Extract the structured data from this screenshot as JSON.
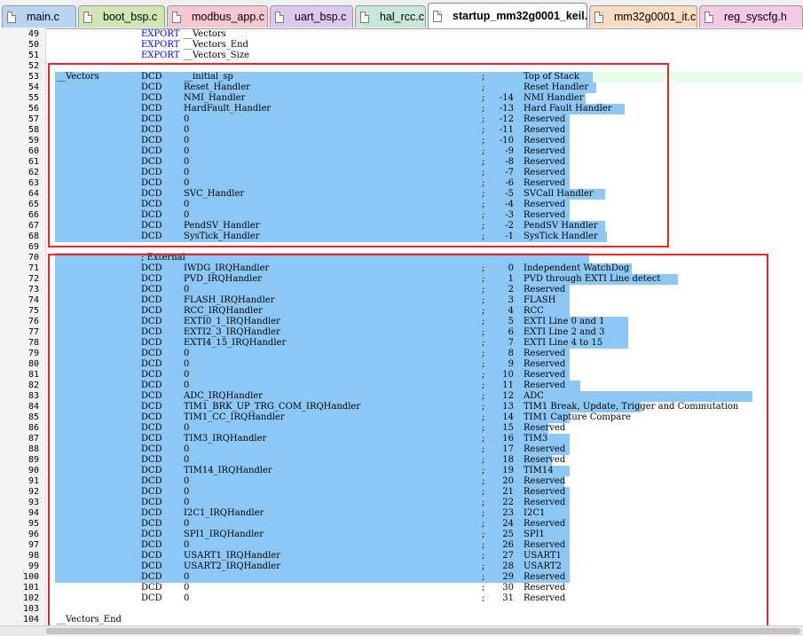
{
  "tabs": [
    {
      "label": "main.c",
      "color": "#b9d4f1",
      "active": false
    },
    {
      "label": "boot_bsp.c",
      "color": "#cfe6b3",
      "active": false
    },
    {
      "label": "modbus_app.c",
      "color": "#f6c7d3",
      "active": false
    },
    {
      "label": "uart_bsp.c",
      "color": "#dcc8ef",
      "active": false
    },
    {
      "label": "hal_rcc.c",
      "color": "#c7e8d9",
      "active": false
    },
    {
      "label": "startup_mm32g0001_keil.s",
      "color": "#ffffff",
      "active": true
    },
    {
      "label": "mm32g0001_it.c",
      "color": "#f9dcc0",
      "active": false
    },
    {
      "label": "reg_syscfg.h",
      "color": "#f3c9e6",
      "active": false
    }
  ],
  "colors": {
    "selection": "#8cc7f5",
    "keyword": "#0000ff",
    "highlight_box": "#e8262a",
    "current_line": "#e8ffe8"
  },
  "lines": [
    {
      "n": "49",
      "c1": "",
      "c2": "EXPORT",
      "c3": "__Vectors",
      "semi": "",
      "num": "",
      "cmt": "",
      "kw": true
    },
    {
      "n": "50",
      "c1": "",
      "c2": "EXPORT",
      "c3": "__Vectors_End",
      "semi": "",
      "num": "",
      "cmt": "",
      "kw": true
    },
    {
      "n": "51",
      "c1": "",
      "c2": "EXPORT",
      "c3": "__Vectors_Size",
      "semi": "",
      "num": "",
      "cmt": "",
      "kw": true
    },
    {
      "n": "52",
      "c1": "",
      "c2": "",
      "c3": "",
      "semi": "",
      "num": "",
      "cmt": ""
    },
    {
      "n": "53",
      "c1": "__Vectors",
      "c2": "DCD",
      "c3": "__initial_sp",
      "semi": ";",
      "num": "",
      "cmt": "Top of Stack"
    },
    {
      "n": "54",
      "c1": "",
      "c2": "DCD",
      "c3": "Reset_Handler",
      "semi": ";",
      "num": "",
      "cmt": "Reset Handler"
    },
    {
      "n": "55",
      "c1": "",
      "c2": "DCD",
      "c3": "NMI_Handler",
      "semi": ";",
      "num": "-14",
      "cmt": "NMI Handler"
    },
    {
      "n": "56",
      "c1": "",
      "c2": "DCD",
      "c3": "HardFault_Handler",
      "semi": ";",
      "num": "-13",
      "cmt": "Hard Fault Handler"
    },
    {
      "n": "57",
      "c1": "",
      "c2": "DCD",
      "c3": "0",
      "semi": ";",
      "num": "-12",
      "cmt": "Reserved"
    },
    {
      "n": "58",
      "c1": "",
      "c2": "DCD",
      "c3": "0",
      "semi": ";",
      "num": "-11",
      "cmt": "Reserved"
    },
    {
      "n": "59",
      "c1": "",
      "c2": "DCD",
      "c3": "0",
      "semi": ";",
      "num": "-10",
      "cmt": "Reserved"
    },
    {
      "n": "60",
      "c1": "",
      "c2": "DCD",
      "c3": "0",
      "semi": ";",
      "num": "-9",
      "cmt": "Reserved"
    },
    {
      "n": "61",
      "c1": "",
      "c2": "DCD",
      "c3": "0",
      "semi": ";",
      "num": "-8",
      "cmt": "Reserved"
    },
    {
      "n": "62",
      "c1": "",
      "c2": "DCD",
      "c3": "0",
      "semi": ";",
      "num": "-7",
      "cmt": "Reserved"
    },
    {
      "n": "63",
      "c1": "",
      "c2": "DCD",
      "c3": "0",
      "semi": ";",
      "num": "-6",
      "cmt": "Reserved"
    },
    {
      "n": "64",
      "c1": "",
      "c2": "DCD",
      "c3": "SVC_Handler",
      "semi": ";",
      "num": "-5",
      "cmt": "SVCall Handler"
    },
    {
      "n": "65",
      "c1": "",
      "c2": "DCD",
      "c3": "0",
      "semi": ";",
      "num": "-4",
      "cmt": "Reserved"
    },
    {
      "n": "66",
      "c1": "",
      "c2": "DCD",
      "c3": "0",
      "semi": ";",
      "num": "-3",
      "cmt": "Reserved"
    },
    {
      "n": "67",
      "c1": "",
      "c2": "DCD",
      "c3": "PendSV_Handler",
      "semi": ";",
      "num": "-2",
      "cmt": "PendSV Handler"
    },
    {
      "n": "68",
      "c1": "",
      "c2": "DCD",
      "c3": "SysTick_Handler",
      "semi": ";",
      "num": "-1",
      "cmt": "SysTick Handler"
    },
    {
      "n": "69",
      "c1": "",
      "c2": "",
      "c3": "",
      "semi": "",
      "num": "",
      "cmt": ""
    },
    {
      "n": "70",
      "c1": "",
      "c2": "; External",
      "c3": "",
      "semi": "",
      "num": "",
      "cmt": ""
    },
    {
      "n": "71",
      "c1": "",
      "c2": "DCD",
      "c3": "IWDG_IRQHandler",
      "semi": ";",
      "num": "0",
      "cmt": "Independent WatchDog"
    },
    {
      "n": "72",
      "c1": "",
      "c2": "DCD",
      "c3": "PVD_IRQHandler",
      "semi": ";",
      "num": "1",
      "cmt": "PVD through EXTI Line detect"
    },
    {
      "n": "73",
      "c1": "",
      "c2": "DCD",
      "c3": "0",
      "semi": ";",
      "num": "2",
      "cmt": "Reserved"
    },
    {
      "n": "74",
      "c1": "",
      "c2": "DCD",
      "c3": "FLASH_IRQHandler",
      "semi": ";",
      "num": "3",
      "cmt": "FLASH"
    },
    {
      "n": "75",
      "c1": "",
      "c2": "DCD",
      "c3": "RCC_IRQHandler",
      "semi": ";",
      "num": "4",
      "cmt": "RCC"
    },
    {
      "n": "76",
      "c1": "",
      "c2": "DCD",
      "c3": "EXTI0_1_IRQHandler",
      "semi": ";",
      "num": "5",
      "cmt": "EXTI Line 0 and 1"
    },
    {
      "n": "77",
      "c1": "",
      "c2": "DCD",
      "c3": "EXTI2_3_IRQHandler",
      "semi": ";",
      "num": "6",
      "cmt": "EXTI Line 2 and 3"
    },
    {
      "n": "78",
      "c1": "",
      "c2": "DCD",
      "c3": "EXTI4_15_IRQHandler",
      "semi": ";",
      "num": "7",
      "cmt": "EXTI Line 4 to 15"
    },
    {
      "n": "79",
      "c1": "",
      "c2": "DCD",
      "c3": "0",
      "semi": ";",
      "num": "8",
      "cmt": "Reserved"
    },
    {
      "n": "80",
      "c1": "",
      "c2": "DCD",
      "c3": "0",
      "semi": ";",
      "num": "9",
      "cmt": "Reserved"
    },
    {
      "n": "81",
      "c1": "",
      "c2": "DCD",
      "c3": "0",
      "semi": ";",
      "num": "10",
      "cmt": "Reserved"
    },
    {
      "n": "82",
      "c1": "",
      "c2": "DCD",
      "c3": "0",
      "semi": ";",
      "num": "11",
      "cmt": "Reserved"
    },
    {
      "n": "83",
      "c1": "",
      "c2": "DCD",
      "c3": "ADC_IRQHandler",
      "semi": ";",
      "num": "12",
      "cmt": "ADC"
    },
    {
      "n": "84",
      "c1": "",
      "c2": "DCD",
      "c3": "TIM1_BRK_UP_TRG_COM_IRQHandler",
      "semi": ";",
      "num": "13",
      "cmt": "TIM1 Break, Update, Trigger and Commutation"
    },
    {
      "n": "85",
      "c1": "",
      "c2": "DCD",
      "c3": "TIM1_CC_IRQHandler",
      "semi": ";",
      "num": "14",
      "cmt": "TIM1 Capture Compare"
    },
    {
      "n": "86",
      "c1": "",
      "c2": "DCD",
      "c3": "0",
      "semi": ";",
      "num": "15",
      "cmt": "Reserved"
    },
    {
      "n": "87",
      "c1": "",
      "c2": "DCD",
      "c3": "TIM3_IRQHandler",
      "semi": ";",
      "num": "16",
      "cmt": "TIM3"
    },
    {
      "n": "88",
      "c1": "",
      "c2": "DCD",
      "c3": "0",
      "semi": ";",
      "num": "17",
      "cmt": "Reserved"
    },
    {
      "n": "89",
      "c1": "",
      "c2": "DCD",
      "c3": "0",
      "semi": ";",
      "num": "18",
      "cmt": "Reserved"
    },
    {
      "n": "90",
      "c1": "",
      "c2": "DCD",
      "c3": "TIM14_IRQHandler",
      "semi": ";",
      "num": "19",
      "cmt": "TIM14"
    },
    {
      "n": "91",
      "c1": "",
      "c2": "DCD",
      "c3": "0",
      "semi": ";",
      "num": "20",
      "cmt": "Reserved"
    },
    {
      "n": "92",
      "c1": "",
      "c2": "DCD",
      "c3": "0",
      "semi": ";",
      "num": "21",
      "cmt": "Reserved"
    },
    {
      "n": "93",
      "c1": "",
      "c2": "DCD",
      "c3": "0",
      "semi": ";",
      "num": "22",
      "cmt": "Reserved"
    },
    {
      "n": "94",
      "c1": "",
      "c2": "DCD",
      "c3": "I2C1_IRQHandler",
      "semi": ";",
      "num": "23",
      "cmt": "I2C1"
    },
    {
      "n": "95",
      "c1": "",
      "c2": "DCD",
      "c3": "0",
      "semi": ";",
      "num": "24",
      "cmt": "Reserved"
    },
    {
      "n": "96",
      "c1": "",
      "c2": "DCD",
      "c3": "SPI1_IRQHandler",
      "semi": ";",
      "num": "25",
      "cmt": "SPI1"
    },
    {
      "n": "97",
      "c1": "",
      "c2": "DCD",
      "c3": "0",
      "semi": ";",
      "num": "26",
      "cmt": "Reserved"
    },
    {
      "n": "98",
      "c1": "",
      "c2": "DCD",
      "c3": "USART1_IRQHandler",
      "semi": ";",
      "num": "27",
      "cmt": "USART1"
    },
    {
      "n": "99",
      "c1": "",
      "c2": "DCD",
      "c3": "USART2_IRQHandler",
      "semi": ";",
      "num": "28",
      "cmt": "USART2"
    },
    {
      "n": "100",
      "c1": "",
      "c2": "DCD",
      "c3": "0",
      "semi": ";",
      "num": "29",
      "cmt": "Reserved"
    },
    {
      "n": "101",
      "c1": "",
      "c2": "DCD",
      "c3": "0",
      "semi": ";",
      "num": "30",
      "cmt": "Reserved"
    },
    {
      "n": "102",
      "c1": "",
      "c2": "DCD",
      "c3": "0",
      "semi": ";",
      "num": "31",
      "cmt": "Reserved"
    },
    {
      "n": "103",
      "c1": "",
      "c2": "",
      "c3": "",
      "semi": "",
      "num": "",
      "cmt": ""
    },
    {
      "n": "104",
      "c1": "__Vectors_End",
      "c2": "",
      "c3": "",
      "semi": "",
      "num": "",
      "cmt": ""
    }
  ]
}
